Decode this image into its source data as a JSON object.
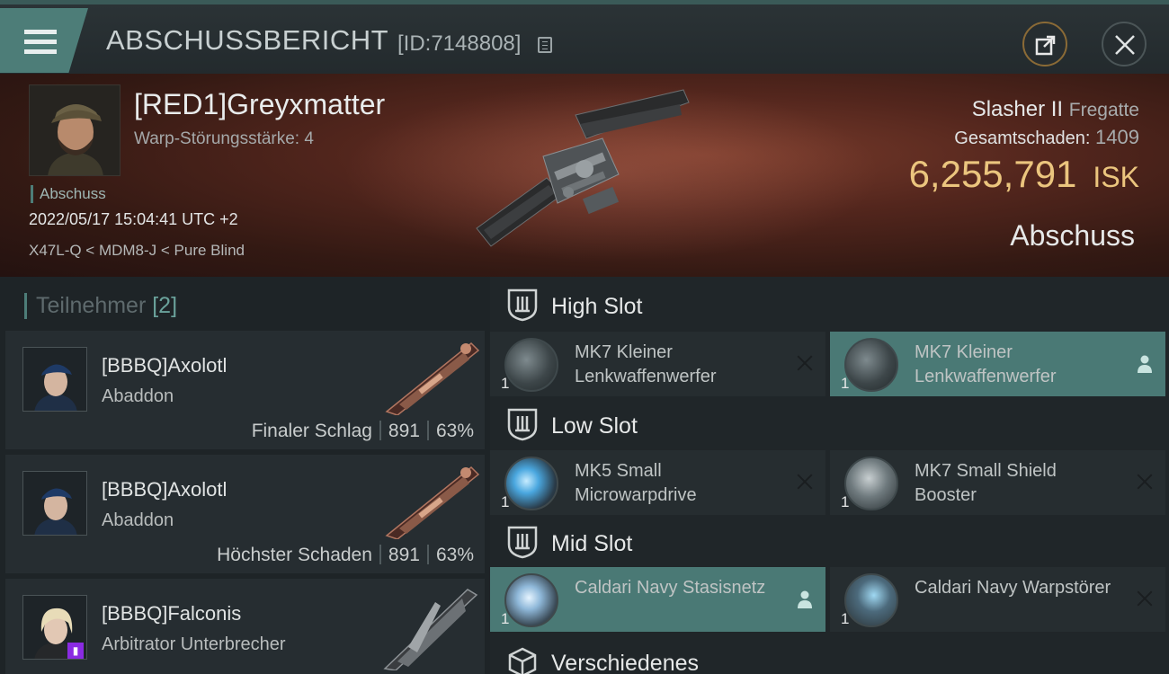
{
  "header": {
    "title": "ABSCHUSSBERICHT",
    "kill_id": "[ID:7148808]"
  },
  "victim": {
    "name": "[RED1]Greyxmatter",
    "warp_disruption": "Warp-Störungsstärke: 4",
    "tag": "Abschuss",
    "datetime": "2022/05/17 15:04:41 UTC +2",
    "location": "X47L-Q < MDM8-J < Pure Blind",
    "ship_name": "Slasher II",
    "ship_class": "Fregatte",
    "damage_label": "Gesamtschaden:",
    "damage_value": "1409",
    "isk_value": "6,255,791",
    "isk_unit": "ISK",
    "result_label": "Abschuss"
  },
  "participants": {
    "title": "Teilnehmer",
    "count": "[2]",
    "list": [
      {
        "name": "[BBBQ]Axolotl",
        "ship": "Abaddon",
        "role": "Finaler Schlag",
        "damage": "891",
        "percent": "63%"
      },
      {
        "name": "[BBBQ]Axolotl",
        "ship": "Abaddon",
        "role": "Höchster Schaden",
        "damage": "891",
        "percent": "63%"
      },
      {
        "name": "[BBBQ]Falconis",
        "ship": "Arbitrator Unterbrecher",
        "role": "",
        "damage": "",
        "percent": ""
      }
    ]
  },
  "slots": {
    "high": {
      "label": "High Slot",
      "modules": [
        {
          "qty": "1",
          "name": "MK7 Kleiner Lenkwaffenwerfer",
          "state": "destroyed"
        },
        {
          "qty": "1",
          "name": "MK7 Kleiner Lenkwaffenwerfer",
          "state": "dropped"
        }
      ]
    },
    "low": {
      "label": "Low Slot",
      "modules": [
        {
          "qty": "1",
          "name": "MK5 Small Microwarpdrive",
          "state": "destroyed"
        },
        {
          "qty": "1",
          "name": "MK7 Small Shield Booster",
          "state": "destroyed"
        }
      ]
    },
    "mid": {
      "label": "Mid Slot",
      "modules": [
        {
          "qty": "1",
          "name": "Caldari Navy Stasisnetz",
          "state": "dropped"
        },
        {
          "qty": "1",
          "name": "Caldari Navy Warpstörer",
          "state": "destroyed"
        }
      ]
    },
    "misc": {
      "label": "Verschiedenes"
    }
  },
  "colors": {
    "accent": "#4d7d78",
    "isk": "#ebc57e",
    "hero_bg": "#53261d"
  }
}
